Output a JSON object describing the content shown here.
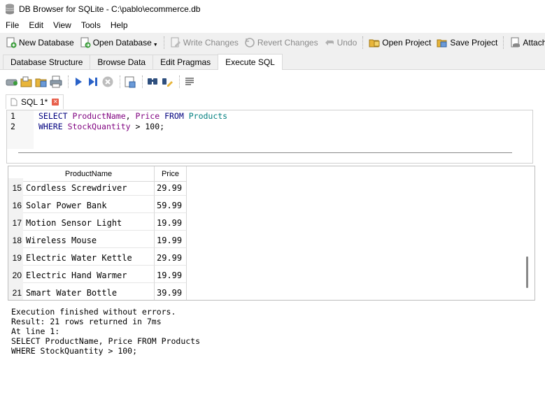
{
  "window": {
    "title": "DB Browser for SQLite - C:\\pablo\\ecommerce.db",
    "app_icon": "database-icon"
  },
  "menu": [
    "File",
    "Edit",
    "View",
    "Tools",
    "Help"
  ],
  "toolbar": {
    "new_database": "New Database",
    "open_database": "Open Database",
    "write_changes": "Write Changes",
    "revert_changes": "Revert Changes",
    "undo": "Undo",
    "open_project": "Open Project",
    "save_project": "Save Project",
    "attach": "Attach"
  },
  "tabs": [
    "Database Structure",
    "Browse Data",
    "Edit Pragmas",
    "Execute SQL"
  ],
  "active_tab": "Execute SQL",
  "sql_tab": {
    "label": "SQL 1*"
  },
  "editor": {
    "lines": [
      {
        "no": "1",
        "tokens": [
          {
            "t": "SELECT",
            "c": "kw"
          },
          {
            "t": " ",
            "c": ""
          },
          {
            "t": "ProductName",
            "c": "id"
          },
          {
            "t": ", ",
            "c": ""
          },
          {
            "t": "Price",
            "c": "id"
          },
          {
            "t": " ",
            "c": ""
          },
          {
            "t": "FROM",
            "c": "kw"
          },
          {
            "t": " ",
            "c": ""
          },
          {
            "t": "Products",
            "c": "tbl"
          }
        ]
      },
      {
        "no": "2",
        "tokens": [
          {
            "t": "WHERE",
            "c": "kw"
          },
          {
            "t": " ",
            "c": ""
          },
          {
            "t": "StockQuantity",
            "c": "id"
          },
          {
            "t": " > 100;",
            "c": ""
          }
        ]
      }
    ]
  },
  "results": {
    "columns": [
      "ProductName",
      "Price"
    ],
    "rows": [
      {
        "n": "15",
        "name": "Cordless Screwdriver",
        "price": "29.99"
      },
      {
        "n": "16",
        "name": "Solar Power Bank",
        "price": "59.99"
      },
      {
        "n": "17",
        "name": "Motion Sensor Light",
        "price": "19.99"
      },
      {
        "n": "18",
        "name": "Wireless Mouse",
        "price": "19.99"
      },
      {
        "n": "19",
        "name": "Electric Water Kettle",
        "price": "29.99"
      },
      {
        "n": "20",
        "name": "Electric Hand Warmer",
        "price": "19.99"
      },
      {
        "n": "21",
        "name": "Smart Water Bottle",
        "price": "39.99"
      }
    ]
  },
  "log": [
    "Execution finished without errors.",
    "Result: 21 rows returned in 7ms",
    "At line 1:",
    "SELECT ProductName, Price FROM Products",
    "WHERE StockQuantity > 100;"
  ],
  "colors": {
    "keyword": "#00007f",
    "identifier": "#7f007f",
    "table": "#007f7f",
    "close_button": "#e8604c"
  }
}
